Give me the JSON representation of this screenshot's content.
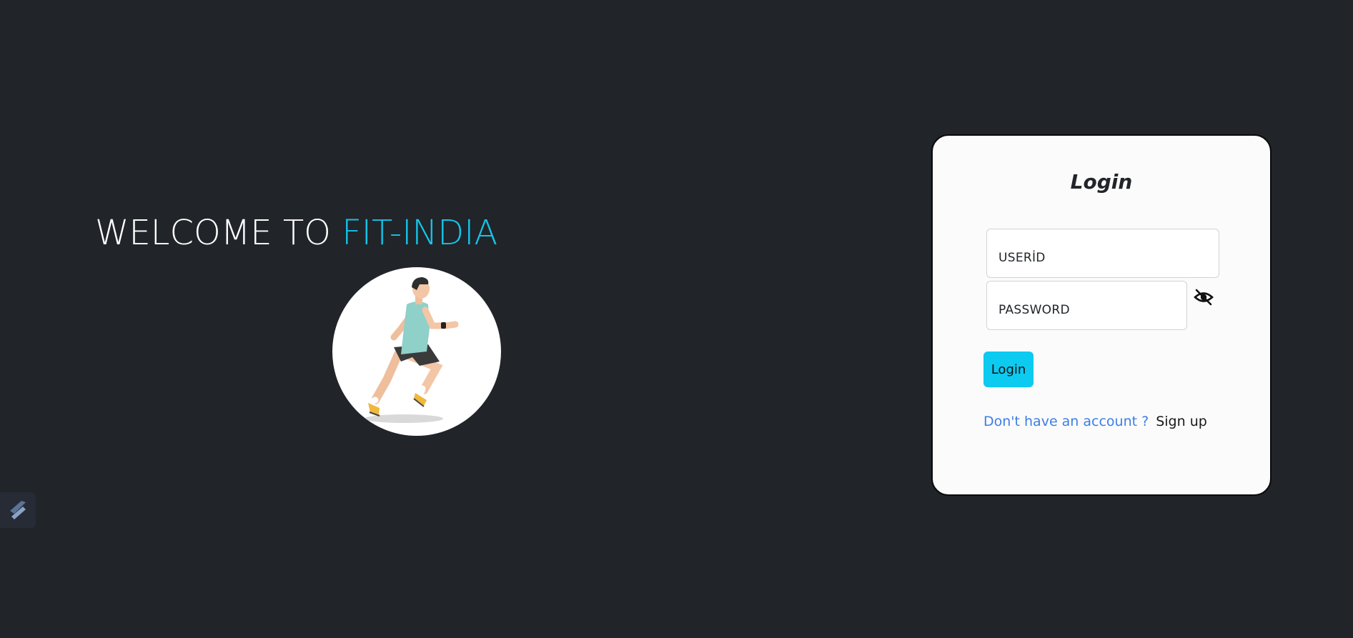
{
  "hero": {
    "welcome_prefix": "WELCOME TO ",
    "brand_name": "FIT-INDIA",
    "brand_color": "#13c5ea",
    "image_icon": "running-man-illustration"
  },
  "login": {
    "title": "Login",
    "userid_label": "USERİD",
    "userid_value": "",
    "password_label": "PASSWORD",
    "password_value": "",
    "toggle_icon": "eye-slash-icon",
    "submit_label": "Login",
    "submit_color": "#0dcaf0",
    "no_account_prompt": "Don't have an account ?",
    "signup_label": "Sign up"
  },
  "corner_widget": {
    "icon": "stylus-logo-icon"
  },
  "colors": {
    "background": "#212429",
    "card": "#fbfbfb",
    "link": "#3d7ee6"
  }
}
